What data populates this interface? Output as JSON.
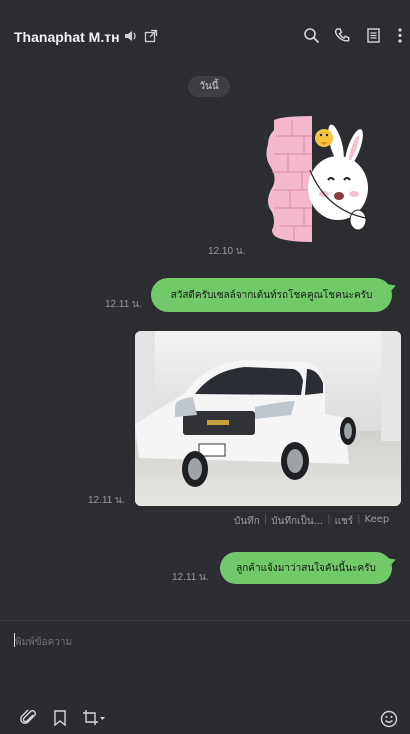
{
  "header": {
    "title": "Thanaphat M.тн",
    "icons": [
      "speaker-icon",
      "open-external-icon",
      "search-icon",
      "phone-icon",
      "notes-icon",
      "more-vert-icon"
    ]
  },
  "chat": {
    "date_label": "วันนี้",
    "messages": [
      {
        "type": "sticker",
        "time": "12.10 น."
      },
      {
        "type": "text",
        "time": "12.11 น.",
        "text": "สวัสดีครับเซลล์จากเต้นท์รถโชคคูณโชคนะครับ"
      },
      {
        "type": "image",
        "time": "12.11 น.",
        "actions": [
          "บันทึก",
          "บันทึกเป็น...",
          "แชร์",
          "Keep"
        ]
      },
      {
        "type": "text",
        "time": "12.11 น.",
        "text": "ลูกค้าแจ้งมาว่าสนใจคันนี้นะครับ"
      }
    ]
  },
  "composer": {
    "placeholder": "พิมพ์ข้อความ",
    "tools": [
      "paperclip-icon",
      "bookmark-icon",
      "crop-icon",
      "emoji-icon"
    ]
  },
  "colors": {
    "background": "#2c2d30",
    "bubble": "#71c96a",
    "pill": "#3d3f43"
  }
}
